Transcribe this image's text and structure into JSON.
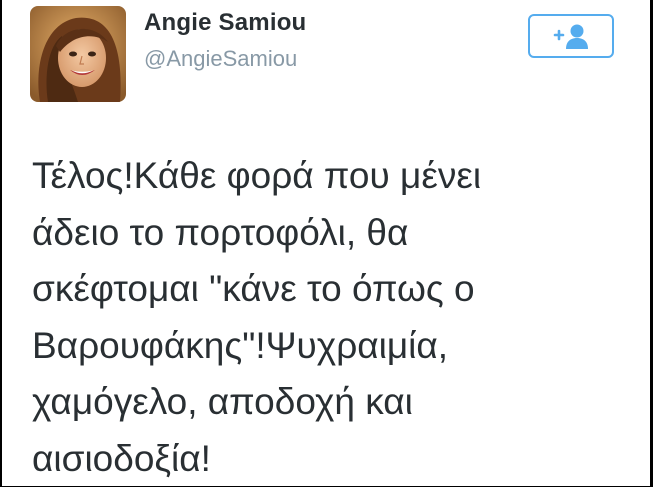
{
  "user": {
    "display_name": "Angie Samiou",
    "handle": "@AngieSamiou"
  },
  "follow_button": {
    "icon": "add-user-icon",
    "accent_color": "#55acee"
  },
  "tweet": {
    "text": "Τέλος!Κάθε φορά που μένει\nάδειο το πορτοφόλι, θα\nσκέφτομαι \"κάνε το όπως ο\nΒαρουφάκης\"!Ψυχραιμία,\nχαμόγελο, αποδοχή και\nαισιοδοξία!"
  },
  "colors": {
    "text": "#292f33",
    "handle": "#8899a6",
    "background": "#ffffff",
    "border": "#000000"
  }
}
